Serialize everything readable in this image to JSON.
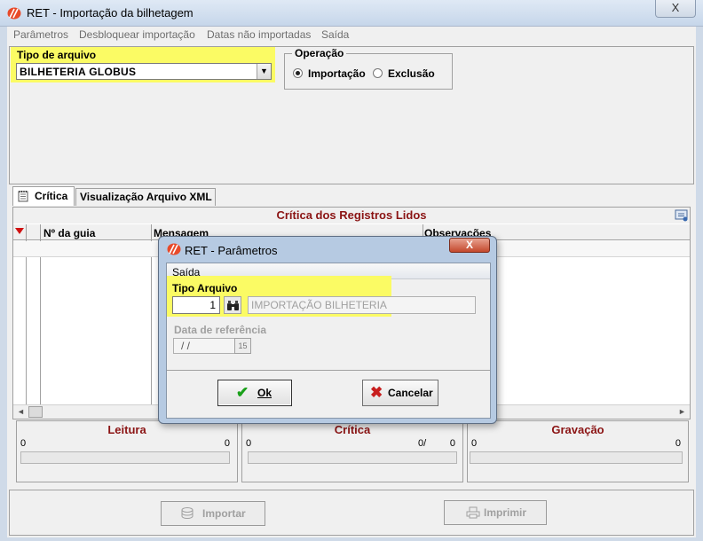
{
  "window": {
    "title": "RET - Importação da bilhetagem",
    "close_label": "X"
  },
  "menu": {
    "items": [
      "Parâmetros",
      "Desbloquear importação",
      "Datas não importadas",
      "Saída"
    ]
  },
  "file_type": {
    "label": "Tipo de arquivo",
    "value": "BILHETERIA GLOBUS"
  },
  "operation": {
    "label": "Operação",
    "option_import": "Importação",
    "option_delete": "Exclusão",
    "selected": "Importação"
  },
  "tabs": [
    {
      "label": "Crítica"
    },
    {
      "label": "Visualização Arquivo XML"
    }
  ],
  "grid": {
    "title": "Crítica dos Registros Lidos",
    "columns": [
      "Nº da guia",
      "Mensagem",
      "Observações"
    ]
  },
  "stats": {
    "leitura": {
      "title": "Leitura",
      "left": "0",
      "right": "0"
    },
    "critica": {
      "title": "Crítica",
      "left": "0",
      "mid": "0/",
      "right": "0"
    },
    "gravacao": {
      "title": "Gravação",
      "left": "0",
      "right": "0"
    }
  },
  "buttons": {
    "importar": "Importar",
    "imprimir": "Imprimir"
  },
  "dialog": {
    "title": "RET - Parâmetros",
    "close_label": "X",
    "menu_item": "Saída",
    "tipo_label": "Tipo Arquivo",
    "tipo_value": "1",
    "tipo_desc": "IMPORTAÇÃO BILHETERIA",
    "data_label": "Data de referência",
    "data_value": "/ /",
    "calendar_label": "15",
    "ok_label": "Ok",
    "cancel_label": "Cancelar"
  },
  "colors": {
    "highlight": "#fbfb64",
    "section_title": "#8b1414",
    "title_bar": "#cfdae8"
  }
}
